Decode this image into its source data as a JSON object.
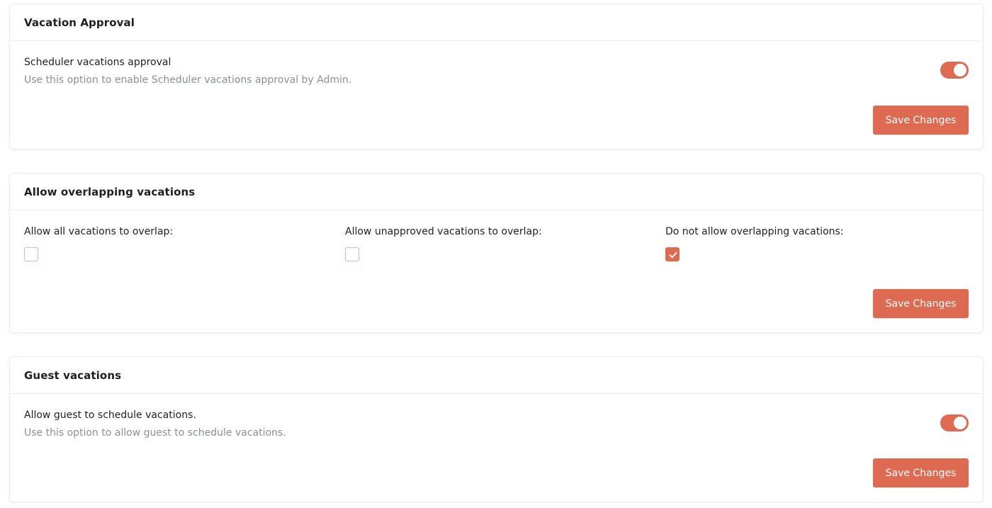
{
  "vacation_approval": {
    "title": "Vacation Approval",
    "option_title": "Scheduler vacations approval",
    "option_description": "Use this option to enable Scheduler vacations approval by Admin.",
    "toggle_on": true,
    "save_label": "Save Changes"
  },
  "overlapping": {
    "title": "Allow overlapping vacations",
    "options": [
      {
        "label": "Allow all vacations to overlap:",
        "checked": false
      },
      {
        "label": "Allow unapproved vacations to overlap:",
        "checked": false
      },
      {
        "label": "Do not allow overlapping vacations:",
        "checked": true
      }
    ],
    "save_label": "Save Changes"
  },
  "guest_vacations": {
    "title": "Guest vacations",
    "option_title": "Allow guest to schedule vacations.",
    "option_description": "Use this option to allow guest to schedule vacations.",
    "toggle_on": true,
    "save_label": "Save Changes"
  },
  "colors": {
    "accent": "#de6a52",
    "checkbox_border": "#ecb2a4",
    "muted_text": "#8a8f98"
  }
}
